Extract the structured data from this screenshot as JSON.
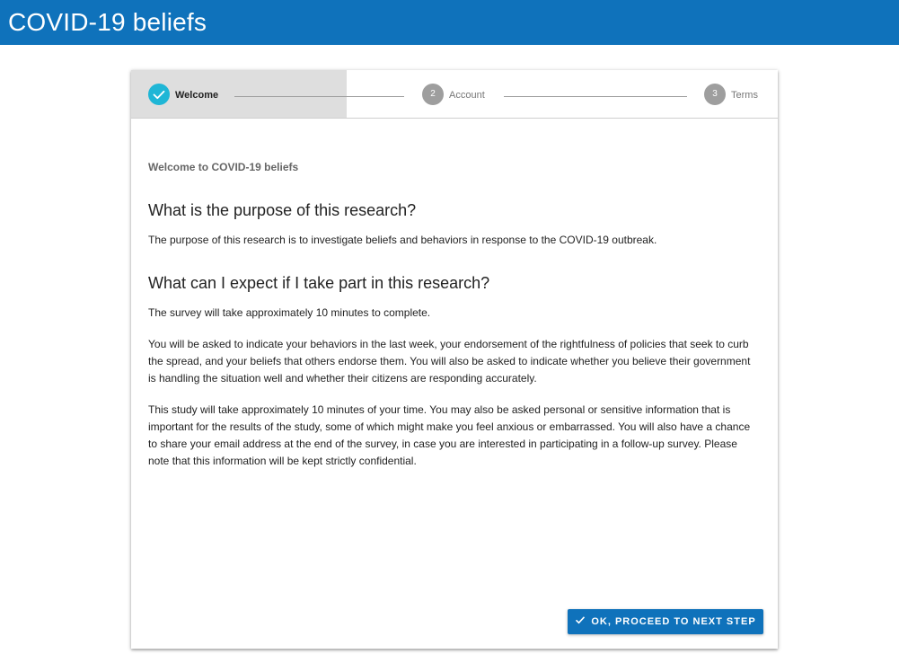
{
  "app": {
    "title": "COVID-19 beliefs"
  },
  "stepper": {
    "steps": [
      {
        "number": "",
        "label": "Welcome",
        "state": "done"
      },
      {
        "number": "2",
        "label": "Account",
        "state": "pending"
      },
      {
        "number": "3",
        "label": "Terms",
        "state": "pending"
      }
    ]
  },
  "main": {
    "welcome": "Welcome to COVID-19 beliefs",
    "section1_title": "What is the purpose of this research?",
    "section1_text": "The purpose of this research is to investigate beliefs and behaviors in response to the COVID-19 outbreak.",
    "section2_title": "What can I expect if I take part in this research?",
    "section2_p1": "The survey will take approximately 10 minutes to complete.",
    "section2_p2": "You will be asked to indicate your behaviors in the last week, your endorsement of the rightfulness of policies that seek to curb the spread, and your beliefs that others endorse them. You will also be asked to indicate whether you believe their government is handling the situation well and whether their citizens are responding accurately.",
    "section2_p3": "This study will take approximately 10 minutes of your time. You may also be asked personal or sensitive information that is important for the results of the study, some of which might make you feel anxious or embarrassed. You will also have a chance to share your email address at the end of the survey, in case you are interested in participating in a follow-up survey. Please note that this information will be kept strictly confidential."
  },
  "actions": {
    "proceed_label": "OK, PROCEED TO NEXT STEP",
    "proceed_icon": "check-icon"
  },
  "colors": {
    "appbar": "#0f72bb",
    "step_done": "#1fb6d6",
    "step_pending": "#9e9e9e",
    "button": "#0f72bb"
  }
}
